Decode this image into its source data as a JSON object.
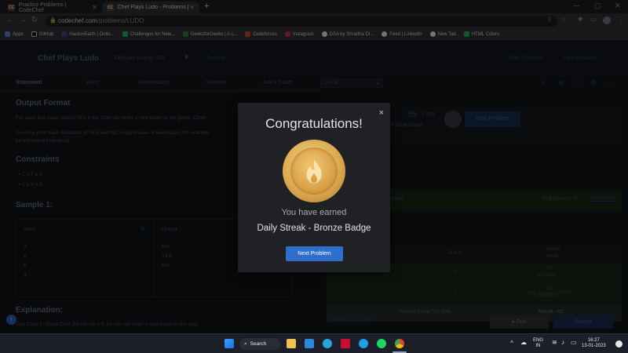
{
  "browser": {
    "tabs": [
      {
        "favicon": "CC",
        "title": "Practice Problems | CodeChef",
        "active": false
      },
      {
        "favicon": "CC",
        "title": "Chef Plays Ludo - Problems | Co",
        "active": true
      }
    ],
    "new_tab": "+",
    "url_domain": "codechef.com",
    "url_path": "/problems/LUDO",
    "bookmarks": [
      {
        "label": "Apps",
        "color": "#6b8fd6"
      },
      {
        "label": "GitHub",
        "color": "#111111"
      },
      {
        "label": "HackerEarth | Onlin...",
        "color": "#3b5998"
      },
      {
        "label": "Challenges for New...",
        "color": "#22c55e"
      },
      {
        "label": "GeeksforGeeks | A c...",
        "color": "#2f8d46"
      },
      {
        "label": "Codeforces",
        "color": "#e44d26"
      },
      {
        "label": "Instagram",
        "color": "#e1306c"
      },
      {
        "label": "DSA by Shradha Di...",
        "color": "#ffffff"
      },
      {
        "label": "Feed | LinkedIn",
        "color": "#0a66c2"
      },
      {
        "label": "New Tab",
        "color": "#ffffff"
      },
      {
        "label": "HTML Colors",
        "color": "#22c55e"
      }
    ]
  },
  "problem": {
    "title": "Chef Plays Ludo",
    "difficulty": "Difficulty Rating: 260",
    "level": "Expand",
    "prev": "Prev Problem",
    "next": "Next Problem",
    "tabs": [
      "Statement",
      "Hints",
      "Submissions",
      "Solution",
      "Ask a Doubt"
    ],
    "language": "C++14"
  },
  "statement": {
    "output_heading": "Output Format",
    "output_line1": "For each test case, output YES if the Chef can enter a new token in the game, Other",
    "output_line2": "You may print each character of YES and NO in uppercase or lowercase (for example",
    "output_line3": "be considered identical).",
    "constraints_heading": "Constraints",
    "constraint1": "1 ≤ T ≤ 6",
    "constraint2": "1 ≤ X ≤ 6",
    "sample_heading": "Sample 1:",
    "input_label": "Input",
    "output_label": "Output",
    "inputs": [
      "3",
      "1",
      "6",
      "3"
    ],
    "outputs": [
      "NO",
      "YES",
      "NO"
    ],
    "explanation_heading": "Explanation:",
    "explanation_text": "Test Case 1: Since Chef did not roll a 6, he can not enter a new token in the play."
  },
  "right": {
    "score": "55",
    "score_total": "/ 250",
    "score_sub": "get Silver Badge",
    "next_problem": "Next Problem",
    "status": "Answer",
    "submission_id_label": "Submission ID:",
    "submission_id": "85404723",
    "col_task": "Task #",
    "col_result": "Result",
    "col_result_sub": "(time)",
    "rows": [
      {
        "task": "0",
        "result": "AC",
        "time": "(0.00sec)"
      },
      {
        "task": "1",
        "result": "AC",
        "time": "(0.00sec)"
      }
    ],
    "subtask_label": "Subtask Score: 100.00%",
    "subtask_result": "Result - AC",
    "total": "Total Score = 100.00%",
    "upload": "Upload code as file",
    "run": "Run",
    "submit": "Submit"
  },
  "modal": {
    "title": "Congratulations!",
    "close": "×",
    "earned": "You have earned",
    "badge_name": "Daily Streak - Bronze Badge",
    "button": "Next Problem"
  },
  "taskbar": {
    "search": "Search",
    "lang_line1": "ENG",
    "lang_line2": "IN",
    "time": "16:27",
    "date": "13-01-2023"
  }
}
